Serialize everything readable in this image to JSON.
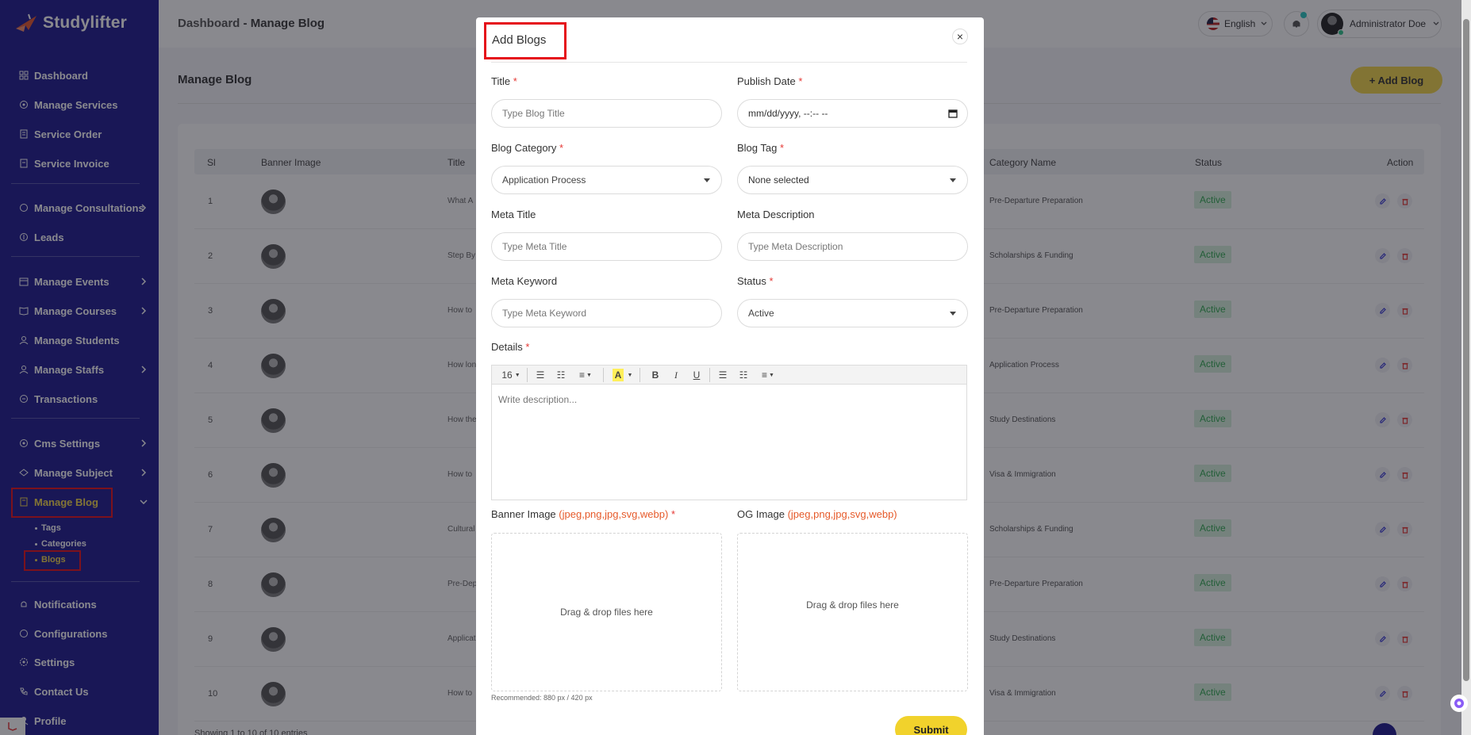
{
  "brand": {
    "name": "Studylifter"
  },
  "sidebar": {
    "items": [
      {
        "label": "Dashboard",
        "icon": "grid-icon"
      },
      {
        "label": "Manage Services",
        "icon": "settings-icon"
      },
      {
        "label": "Service Order",
        "icon": "receipt-icon"
      },
      {
        "label": "Service Invoice",
        "icon": "invoice-icon"
      },
      {
        "label": "Manage Consultations",
        "icon": "chat-icon"
      },
      {
        "label": "Leads",
        "icon": "lead-icon"
      },
      {
        "label": "Manage Events",
        "icon": "calendar-icon"
      },
      {
        "label": "Manage Courses",
        "icon": "book-icon"
      },
      {
        "label": "Manage Students",
        "icon": "student-icon"
      },
      {
        "label": "Manage Staffs",
        "icon": "staff-icon"
      },
      {
        "label": "Transactions",
        "icon": "transaction-icon"
      },
      {
        "label": "Cms Settings",
        "icon": "cms-icon"
      },
      {
        "label": "Manage Subject",
        "icon": "subject-icon"
      },
      {
        "label": "Manage Blog",
        "icon": "blog-icon"
      },
      {
        "label": "Notifications",
        "icon": "bell-icon"
      },
      {
        "label": "Configurations",
        "icon": "config-icon"
      },
      {
        "label": "Settings",
        "icon": "gear-icon"
      },
      {
        "label": "Contact Us",
        "icon": "phone-icon"
      },
      {
        "label": "Profile",
        "icon": "user-icon"
      }
    ],
    "blog_sub": [
      "Tags",
      "Categories",
      "Blogs"
    ]
  },
  "header": {
    "breadcrumb_root": "Dashboard",
    "breadcrumb_sep": "-",
    "breadcrumb_current": "Manage Blog",
    "language": "English",
    "user_name": "Administrator Doe"
  },
  "page": {
    "title": "Manage Blog",
    "add_button": "+ Add Blog",
    "columns": [
      "Sl",
      "Banner Image",
      "Title",
      "Category Name",
      "Status",
      "Action"
    ],
    "rows": [
      {
        "sl": "1",
        "title": "What A",
        "category": "Pre-Departure Preparation",
        "status": "Active"
      },
      {
        "sl": "2",
        "title": "Step By",
        "category": "Scholarships & Funding",
        "status": "Active"
      },
      {
        "sl": "3",
        "title": "How to",
        "category": "Pre-Departure Preparation",
        "status": "Active"
      },
      {
        "sl": "4",
        "title": "How lon",
        "category": "Application Process",
        "status": "Active"
      },
      {
        "sl": "5",
        "title": "How the",
        "category": "Study Destinations",
        "status": "Active"
      },
      {
        "sl": "6",
        "title": "How to",
        "category": "Visa & Immigration",
        "status": "Active"
      },
      {
        "sl": "7",
        "title": "Cultural",
        "category": "Scholarships & Funding",
        "status": "Active"
      },
      {
        "sl": "8",
        "title": "Pre-Dep",
        "category": "Pre-Departure Preparation",
        "status": "Active"
      },
      {
        "sl": "9",
        "title": "Applicat",
        "category": "Study Destinations",
        "status": "Active"
      },
      {
        "sl": "10",
        "title": "How to",
        "category": "Visa & Immigration",
        "status": "Active"
      }
    ],
    "footer": "Showing 1 to 10 of 10 entries"
  },
  "modal": {
    "title": "Add Blogs",
    "close": "×",
    "fields": {
      "title_label": "Title",
      "title_placeholder": "Type Blog Title",
      "publish_label": "Publish Date",
      "publish_value": "mm/dd/yyyy, --:-- --",
      "category_label": "Blog Category",
      "category_value": "Application Process",
      "tag_label": "Blog Tag",
      "tag_value": "None selected",
      "meta_title_label": "Meta Title",
      "meta_title_placeholder": "Type Meta Title",
      "meta_desc_label": "Meta Description",
      "meta_desc_placeholder": "Type Meta Description",
      "meta_keyword_label": "Meta Keyword",
      "meta_keyword_placeholder": "Type Meta Keyword",
      "status_label": "Status",
      "status_value": "Active",
      "details_label": "Details",
      "font_size": "16",
      "details_placeholder": "Write description...",
      "banner_label": "Banner Image",
      "banner_ext": "(jpeg,png,jpg,svg,webp)",
      "og_label": "OG Image",
      "og_ext": "(jpeg,png,jpg,svg,webp)",
      "dropzone_text": "Drag & drop files here",
      "recommended": "Recommended: 880 px / 420 px",
      "required_mark": "*"
    },
    "submit": "Submit"
  },
  "colors": {
    "sidebar": "#1f1b8f",
    "accent": "#f1d54a",
    "highlight": "#e5101a",
    "active_badge": "#d6f1dd"
  }
}
